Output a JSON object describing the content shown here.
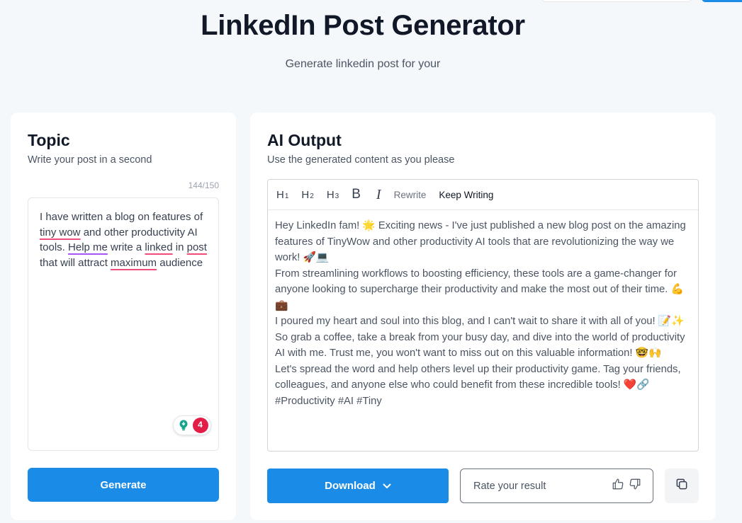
{
  "header": {
    "title": "LinkedIn Post Generator",
    "subtitle": "Generate linkedin post for your"
  },
  "topic_card": {
    "title": "Topic",
    "description": "Write your post in a second",
    "char_count": "144/150",
    "input_segments": [
      {
        "text": "I have written a blog on features of ",
        "mark": "none"
      },
      {
        "text": "tiny wow",
        "mark": "red"
      },
      {
        "text": " and other productivity AI tools. ",
        "mark": "none"
      },
      {
        "text": "Help me",
        "mark": "purple"
      },
      {
        "text": " write a ",
        "mark": "none"
      },
      {
        "text": "linked",
        "mark": "red"
      },
      {
        "text": " in ",
        "mark": "none"
      },
      {
        "text": "post",
        "mark": "red"
      },
      {
        "text": " that will attract ",
        "mark": "none"
      },
      {
        "text": "maximum",
        "mark": "red"
      },
      {
        "text": " audience",
        "mark": "none"
      }
    ],
    "grammar_count": "4",
    "generate_label": "Generate"
  },
  "output_card": {
    "title": "AI Output",
    "description": "Use the generated content as you please",
    "toolbar": {
      "h1": "H",
      "h1_sub": "1",
      "h2": "H",
      "h2_sub": "2",
      "h3": "H",
      "h3_sub": "3",
      "bold": "B",
      "italic": "I",
      "rewrite": "Rewrite",
      "keep_writing": "Keep Writing"
    },
    "paragraphs": [
      "Hey LinkedIn fam! 🌟 Exciting news - I've just published a new blog post on the amazing features of TinyWow and other productivity AI tools that are revolutionizing the way we work! 🚀💻",
      "From streamlining workflows to boosting efficiency, these tools are a game-changer for anyone looking to supercharge their productivity and make the most out of their time. 💪💼",
      "I poured my heart and soul into this blog, and I can't wait to share it with all of you! 📝✨ So grab a coffee, take a break from your busy day, and dive into the world of productivity AI with me. Trust me, you won't want to miss out on this valuable information! 🤓🙌",
      "Let's spread the word and help others level up their productivity game. Tag your friends, colleagues, and anyone else who could benefit from these incredible tools! ❤️🔗 #Productivity #AI #Tiny"
    ],
    "download_label": "Download",
    "rate_placeholder": "Rate your result"
  },
  "colors": {
    "accent": "#1a8be6",
    "spell_underline": "#ef4c7a",
    "grammar_underline": "#a855f7",
    "badge_red": "#e11d48"
  },
  "icons": [
    "chevron-down-icon",
    "thumbs-up-icon",
    "thumbs-down-icon",
    "copy-icon",
    "bulb-icon"
  ]
}
